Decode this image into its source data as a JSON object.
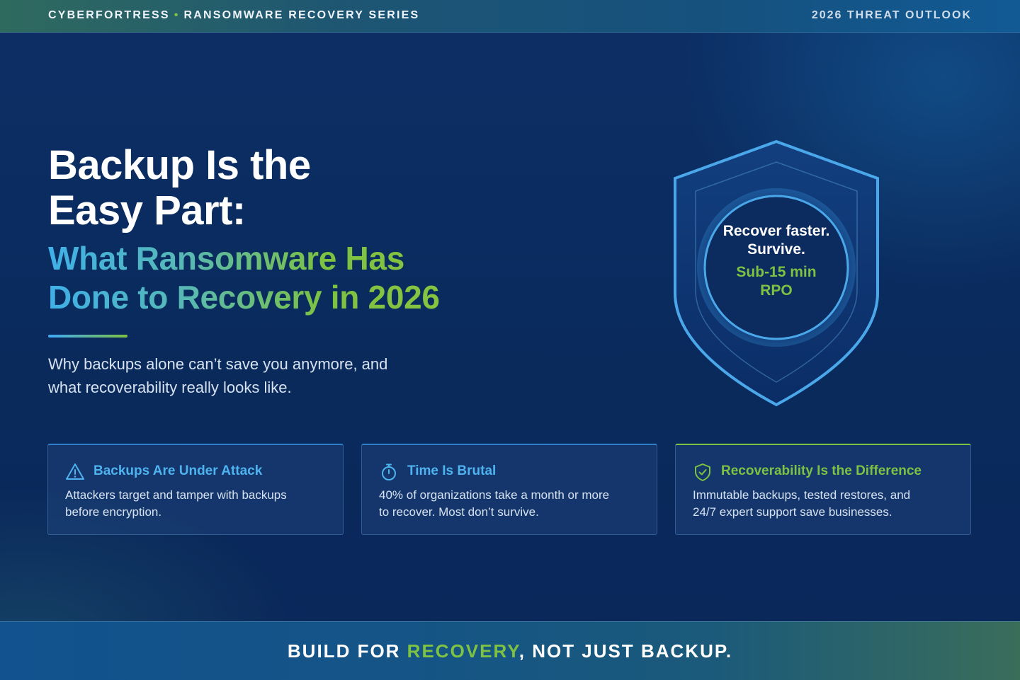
{
  "topbar": {
    "brand": "CYBERFORTRESS",
    "separator": "•",
    "series": "RANSOMWARE RECOVERY SERIES",
    "right_label": "2026 THREAT OUTLOOK"
  },
  "hero": {
    "title_line1": "Backup Is the",
    "title_line2": "Easy Part:",
    "subtitle_line1": "What Ransomware Has",
    "subtitle_line2": "Done to Recovery in 2026",
    "lead_line1": "Why backups alone can’t save you anymore, and",
    "lead_line2": "what recoverability really looks like."
  },
  "shield": {
    "line1": "Recover faster.",
    "line2": "Survive.",
    "line3": "Sub-15 min",
    "line4": "RPO",
    "icon": "shield-icon"
  },
  "cards": [
    {
      "icon": "warning-icon",
      "title": "Backups Are Under Attack",
      "body_line1": "Attackers target and tamper with backups",
      "body_line2": "before encryption."
    },
    {
      "icon": "stopwatch-icon",
      "title": "Time Is Brutal",
      "body_line1": "40% of organizations take a month or more",
      "body_line2": "to recover. Most don’t survive."
    },
    {
      "icon": "shield-check-icon",
      "title": "Recoverability Is the Difference",
      "body_line1": "Immutable backups, tested restores, and",
      "body_line2": "24/7 expert support save businesses."
    }
  ],
  "footer": {
    "part1": "BUILD FOR ",
    "accent": "RECOVERY",
    "part2": ", NOT JUST BACKUP."
  },
  "colors": {
    "background": "#0b2a5e",
    "accent_blue": "#4fb3ef",
    "accent_green": "#7dc242",
    "text_light": "#d7e2ef"
  }
}
